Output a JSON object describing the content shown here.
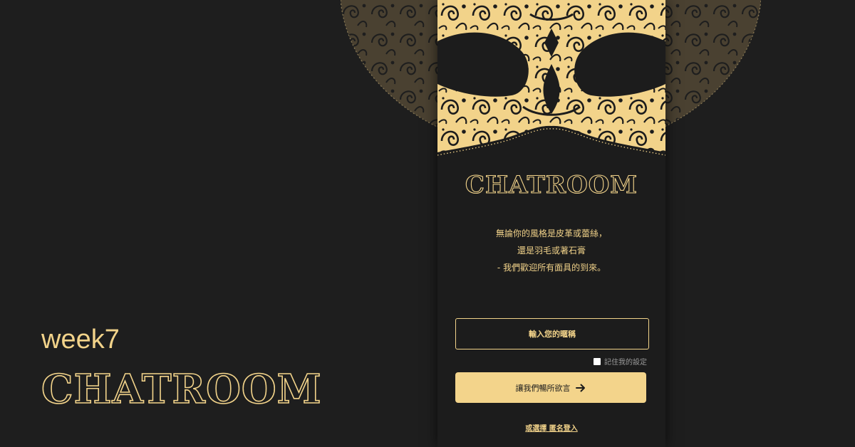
{
  "caption": {
    "week": "week7",
    "title": "CHATROOM"
  },
  "panel": {
    "title": "CHATROOM",
    "tagline": [
      "無論你的風格是皮革或蕾絲，",
      "還是羽毛或著石膏",
      "- 我們歡迎所有面具的到來。"
    ],
    "nickname_placeholder": "輸入您的暱稱",
    "remember_label": "記住我的設定",
    "remember_checked": false,
    "enter_label": "讓我們暢所欲言",
    "enter_icon": "arrow-right-icon",
    "anonymous_link": "或選擇 匿名登入"
  },
  "colors": {
    "background": "#1e1e1e",
    "panel": "#1c1c1c",
    "accent": "#f2d38a",
    "mask_dark": "#4a4131"
  }
}
